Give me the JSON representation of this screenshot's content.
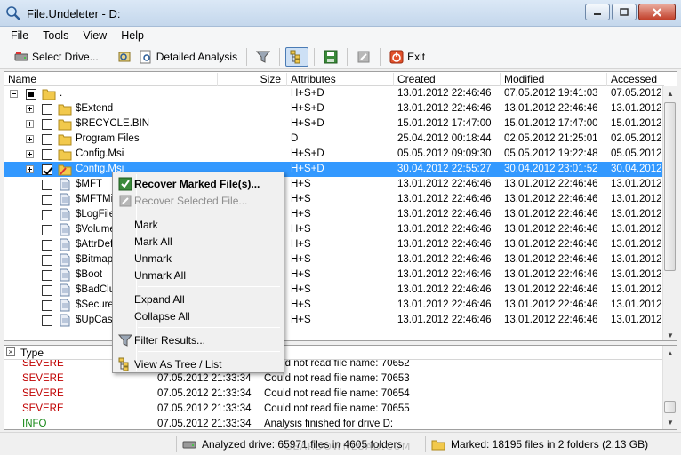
{
  "window": {
    "title": "File.Undeleter - D:"
  },
  "menubar": {
    "items": [
      "File",
      "Tools",
      "View",
      "Help"
    ]
  },
  "toolbar": {
    "select_drive": "Select Drive...",
    "detailed_analysis": "Detailed Analysis",
    "exit": "Exit"
  },
  "tree": {
    "columns": [
      "Name",
      "Size",
      "Attributes",
      "Created",
      "Modified",
      "Accessed"
    ],
    "rows": [
      {
        "name": ".",
        "size": "",
        "attributes": "H+S+D",
        "created": "13.01.2012 22:46:46",
        "modified": "07.05.2012 19:41:03",
        "accessed": "07.05.2012"
      },
      {
        "name": "$Extend",
        "size": "",
        "attributes": "H+S+D",
        "created": "13.01.2012 22:46:46",
        "modified": "13.01.2012 22:46:46",
        "accessed": "13.01.2012"
      },
      {
        "name": "$RECYCLE.BIN",
        "size": "",
        "attributes": "H+S+D",
        "created": "15.01.2012 17:47:00",
        "modified": "15.01.2012 17:47:00",
        "accessed": "15.01.2012"
      },
      {
        "name": "Program Files",
        "size": "",
        "attributes": "D",
        "created": "25.04.2012 00:18:44",
        "modified": "02.05.2012 21:25:01",
        "accessed": "02.05.2012"
      },
      {
        "name": "Config.Msi",
        "size": "",
        "attributes": "H+S+D",
        "created": "05.05.2012 09:09:30",
        "modified": "05.05.2012 19:22:48",
        "accessed": "05.05.2012"
      },
      {
        "name": "Config.Msi",
        "size": "",
        "attributes": "H+S+D",
        "created": "30.04.2012 22:55:27",
        "modified": "30.04.2012 23:01:52",
        "accessed": "30.04.2012"
      },
      {
        "name": "$MFT",
        "size": "",
        "attributes": "H+S",
        "created": "13.01.2012 22:46:46",
        "modified": "13.01.2012 22:46:46",
        "accessed": "13.01.2012"
      },
      {
        "name": "$MFTMirr",
        "size": "",
        "attributes": "H+S",
        "created": "13.01.2012 22:46:46",
        "modified": "13.01.2012 22:46:46",
        "accessed": "13.01.2012"
      },
      {
        "name": "$LogFile",
        "size": "",
        "attributes": "H+S",
        "created": "13.01.2012 22:46:46",
        "modified": "13.01.2012 22:46:46",
        "accessed": "13.01.2012"
      },
      {
        "name": "$Volume",
        "size": "",
        "attributes": "H+S",
        "created": "13.01.2012 22:46:46",
        "modified": "13.01.2012 22:46:46",
        "accessed": "13.01.2012"
      },
      {
        "name": "$AttrDef",
        "size": "",
        "attributes": "H+S",
        "created": "13.01.2012 22:46:46",
        "modified": "13.01.2012 22:46:46",
        "accessed": "13.01.2012"
      },
      {
        "name": "$Bitmap",
        "size": "",
        "attributes": "H+S",
        "created": "13.01.2012 22:46:46",
        "modified": "13.01.2012 22:46:46",
        "accessed": "13.01.2012"
      },
      {
        "name": "$Boot",
        "size": "",
        "attributes": "H+S",
        "created": "13.01.2012 22:46:46",
        "modified": "13.01.2012 22:46:46",
        "accessed": "13.01.2012"
      },
      {
        "name": "$BadClus",
        "size": "",
        "attributes": "H+S",
        "created": "13.01.2012 22:46:46",
        "modified": "13.01.2012 22:46:46",
        "accessed": "13.01.2012"
      },
      {
        "name": "$Secure",
        "size": "",
        "attributes": "H+S",
        "created": "13.01.2012 22:46:46",
        "modified": "13.01.2012 22:46:46",
        "accessed": "13.01.2012"
      },
      {
        "name": "$UpCase",
        "size": "",
        "attributes": "H+S",
        "created": "13.01.2012 22:46:46",
        "modified": "13.01.2012 22:46:46",
        "accessed": "13.01.2012"
      }
    ]
  },
  "context_menu": {
    "recover_marked": "Recover Marked File(s)...",
    "recover_selected": "Recover Selected File...",
    "mark": "Mark",
    "mark_all": "Mark All",
    "unmark": "Unmark",
    "unmark_all": "Unmark All",
    "expand_all": "Expand All",
    "collapse_all": "Collapse All",
    "filter_results": "Filter Results...",
    "view_as_tree": "View As Tree / List"
  },
  "log": {
    "columns": [
      "Type",
      "",
      "age"
    ],
    "rows": [
      {
        "type": "SEVERE",
        "time": "",
        "message": "Could not read file name: 70652"
      },
      {
        "type": "SEVERE",
        "time": "07.05.2012 21:33:34",
        "message": "Could not read file name: 70653"
      },
      {
        "type": "SEVERE",
        "time": "07.05.2012 21:33:34",
        "message": "Could not read file name: 70654"
      },
      {
        "type": "SEVERE",
        "time": "07.05.2012 21:33:34",
        "message": "Could not read file name: 70655"
      },
      {
        "type": "INFO",
        "time": "07.05.2012 21:33:34",
        "message": "Analysis finished for drive D:"
      }
    ]
  },
  "status": {
    "analyzed": "Analyzed drive: 65971 files in 4605 folders",
    "marked": "Marked: 18195 files in 2 folders (2.13 GB)"
  },
  "watermark": "GEARDOWNLOAD.COM",
  "colors": {
    "selection": "#3399ff",
    "severe": "#c00000",
    "info": "#1a8a1a",
    "folder": "#f2c94c"
  }
}
